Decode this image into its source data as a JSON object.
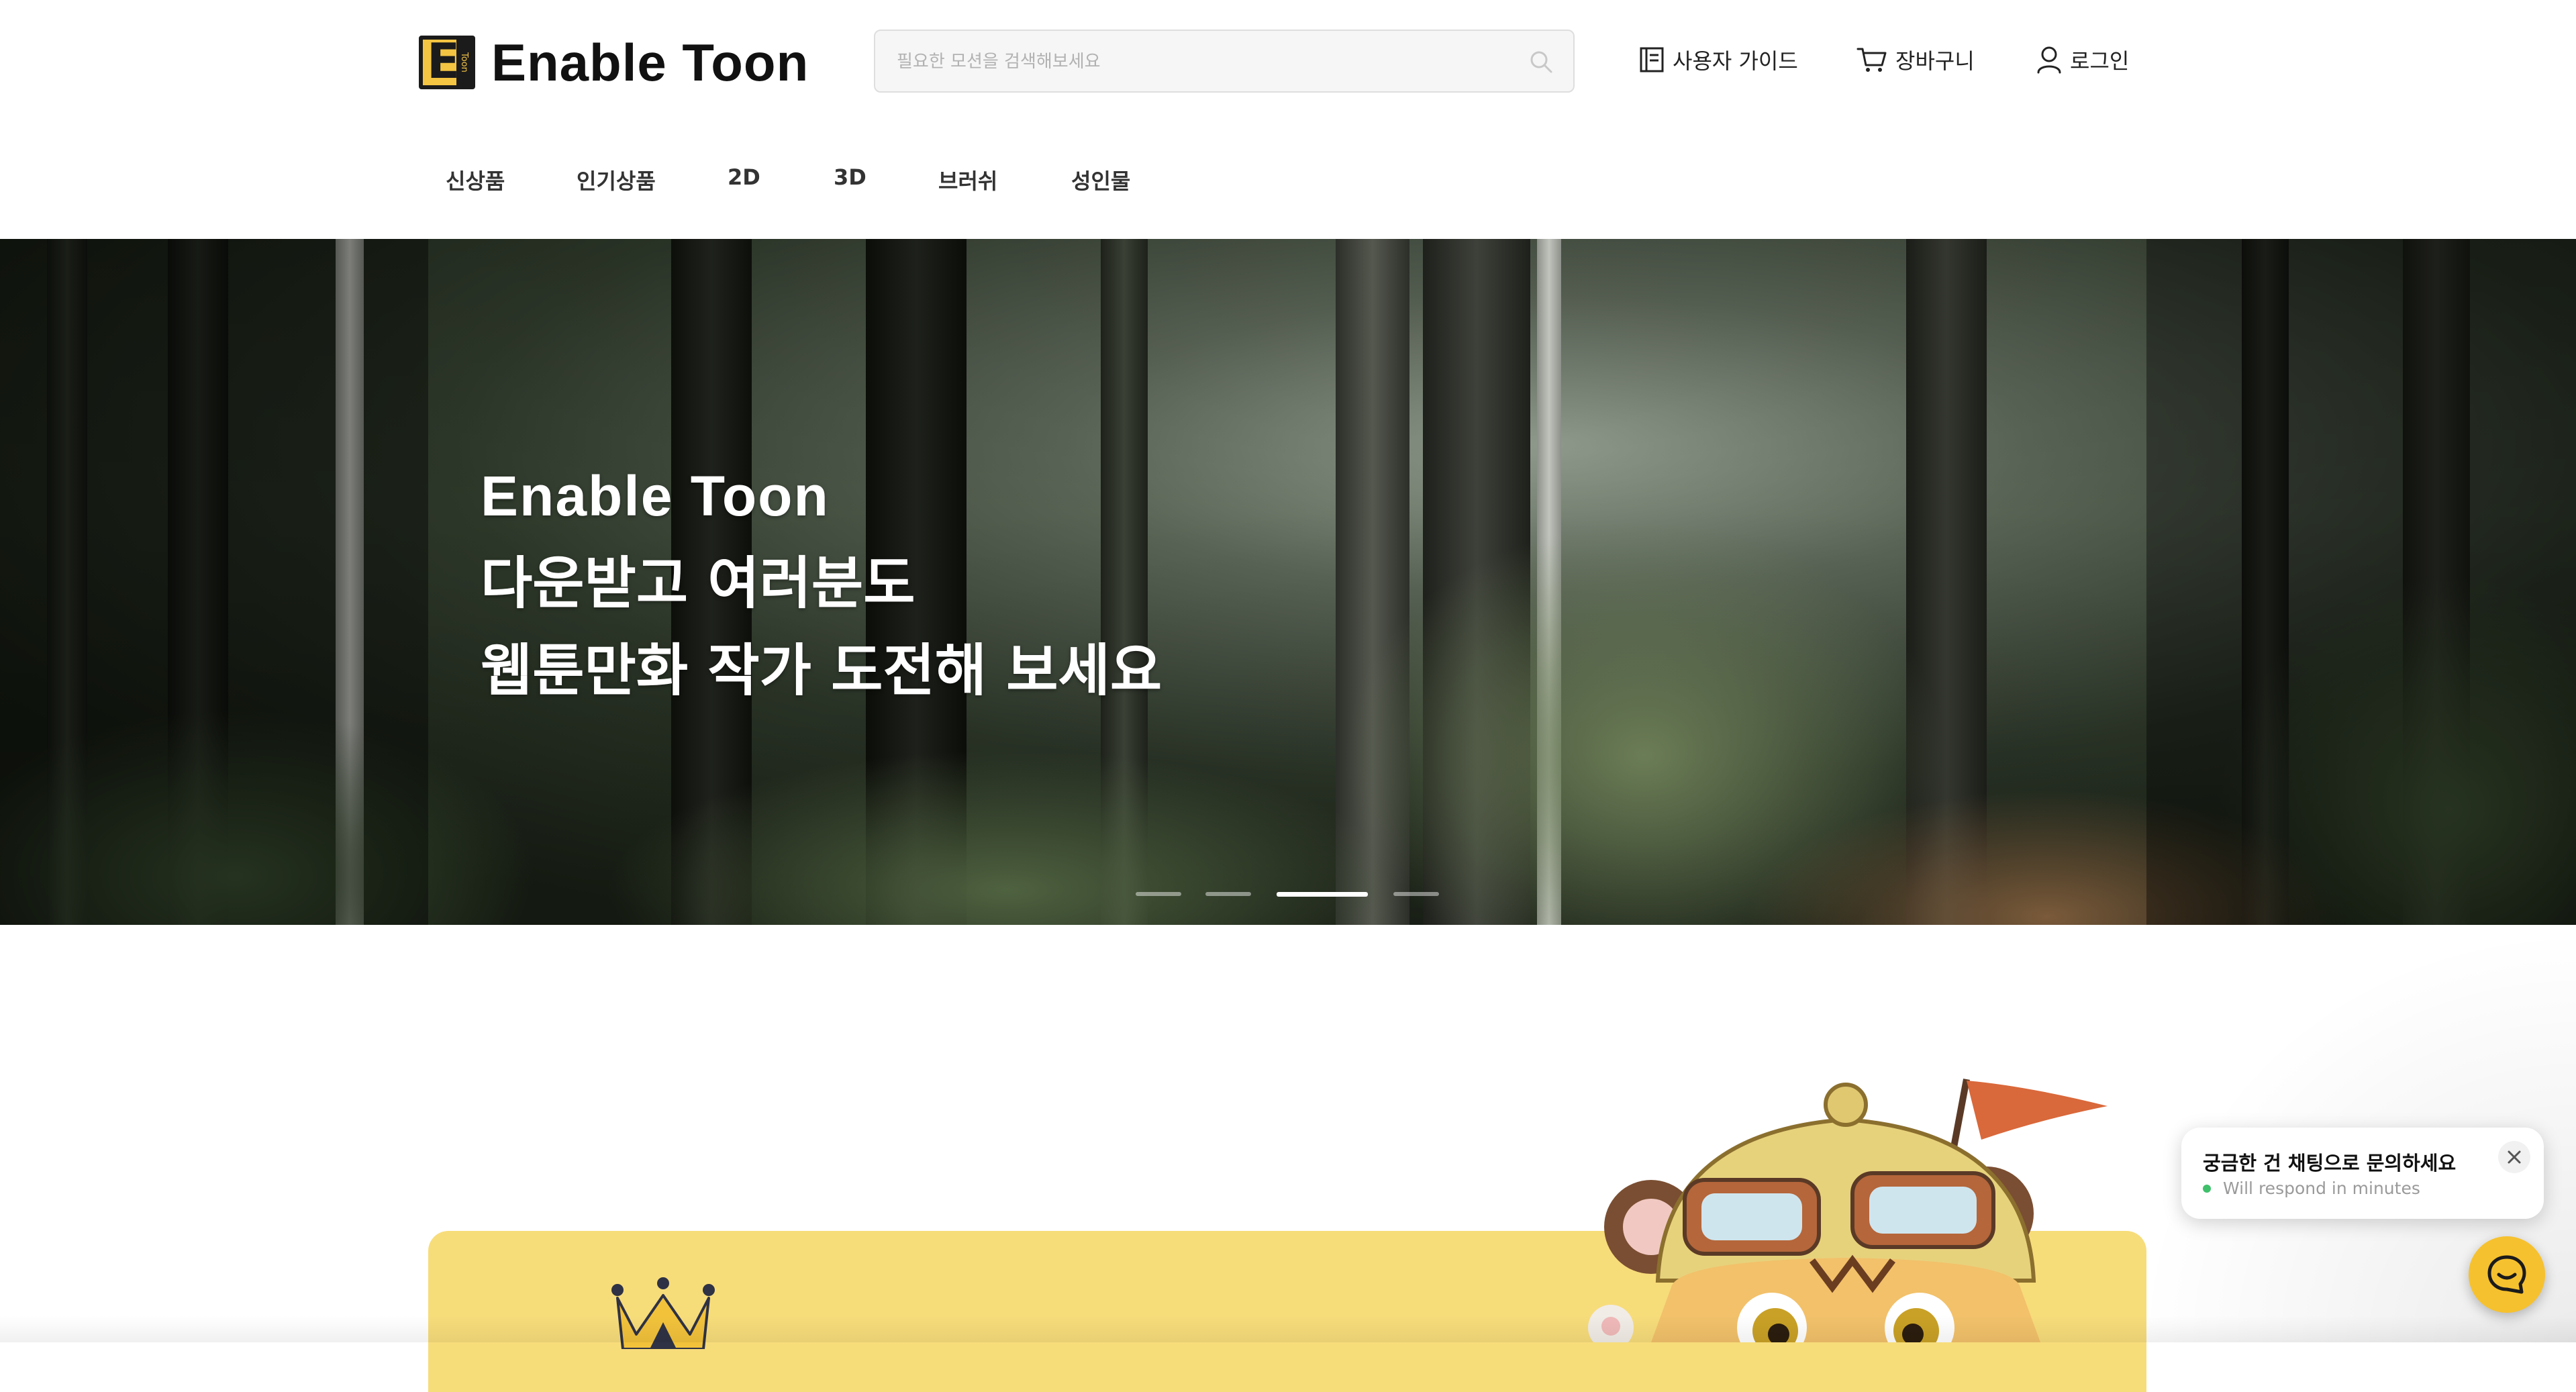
{
  "brand": {
    "name": "Enable Toon",
    "mark_letter": "E",
    "mark_sub": "Toon"
  },
  "search": {
    "placeholder": "필요한 모션을 검색해보세요",
    "value": ""
  },
  "top_links": {
    "guide": "사용자 가이드",
    "cart": "장바구니",
    "login": "로그인"
  },
  "nav": {
    "items": [
      {
        "label": "신상품"
      },
      {
        "label": "인기상품"
      },
      {
        "label": "2D"
      },
      {
        "label": "3D"
      },
      {
        "label": "브러쉬"
      },
      {
        "label": "성인물"
      }
    ]
  },
  "hero": {
    "line1": "Enable Toon",
    "line2": "다운받고 여러분도",
    "line3": "웹툰만화 작가 도전해 보세요",
    "slides_total": 4,
    "active_slide": 3
  },
  "chat": {
    "title": "궁금한 건 채팅으로 문의하세요",
    "status": "Will respond in minutes"
  },
  "colors": {
    "accent_yellow": "#f6c12e",
    "promo_yellow": "#f7dc7a",
    "online_green": "#3fc06b",
    "text_dark": "#222222"
  },
  "icons": {
    "search": "search-icon",
    "guide": "book-icon",
    "cart": "cart-icon",
    "login": "user-icon",
    "close": "close-icon",
    "chat": "chat-icon",
    "crown": "crown-icon"
  }
}
